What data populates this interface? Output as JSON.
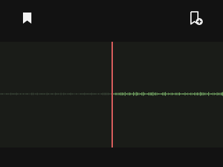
{
  "toolbar": {
    "left_icon": "bookmark-icon",
    "right_icon": "add-bookmark-icon"
  },
  "waveform": {
    "playhead_position": 0.5,
    "colors": {
      "background": "#1a1c18",
      "played_wave": "#3e4a3c",
      "upcoming_wave": "#8fd07a",
      "playhead": "#e06060"
    }
  }
}
